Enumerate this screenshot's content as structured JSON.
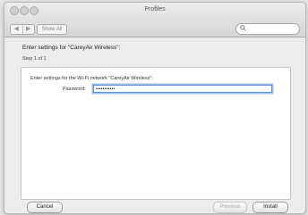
{
  "window": {
    "title": "Profiles"
  },
  "toolbar": {
    "back_label": "◀",
    "forward_label": "▶",
    "show_all_label": "Show All",
    "search_placeholder": "",
    "search_icon": "search-icon"
  },
  "content": {
    "heading": "Enter settings for \"CareyAir Wireless\":",
    "step": "Step 1 of 1",
    "panel_text": "Enter settings for the Wi-Fi network \"CareyAir Wireless\":",
    "password_label": "Password:",
    "password_value": "•••••••••••"
  },
  "buttons": {
    "cancel": "Cancel",
    "previous": "Previous",
    "install": "Install"
  },
  "footer": {
    "left_control": "◀ ▸",
    "help": "?"
  },
  "colors": {
    "focus_ring": "#5d8ed6"
  }
}
